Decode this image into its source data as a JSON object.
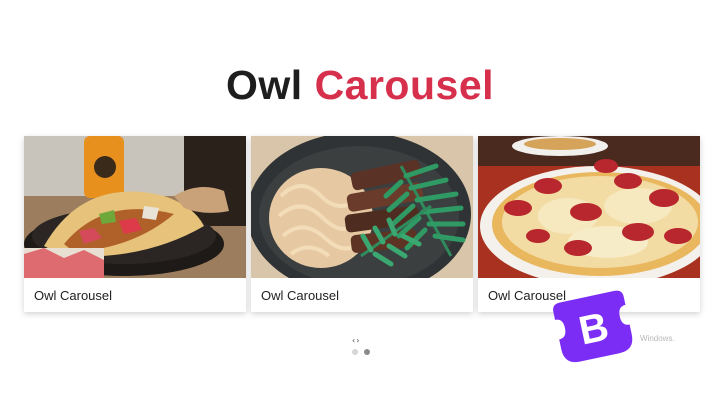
{
  "header": {
    "title_word1": "Owl",
    "title_word2": "Carousel"
  },
  "carousel": {
    "items": [
      {
        "caption": "Owl Carousel",
        "image": "tacos-photo"
      },
      {
        "caption": "Owl Carousel",
        "image": "steak-noodles-photo"
      },
      {
        "caption": "Owl Carousel",
        "image": "pepperoni-pizza-photo"
      }
    ],
    "nav": {
      "prev": "‹",
      "next": "›"
    },
    "dots": {
      "count": 2,
      "active_index": 1
    }
  },
  "overlay": {
    "logo_letter": "B",
    "watermark": "Windows."
  },
  "colors": {
    "accent": "#d7304d",
    "bootstrap_purple": "#7b2cf5"
  }
}
